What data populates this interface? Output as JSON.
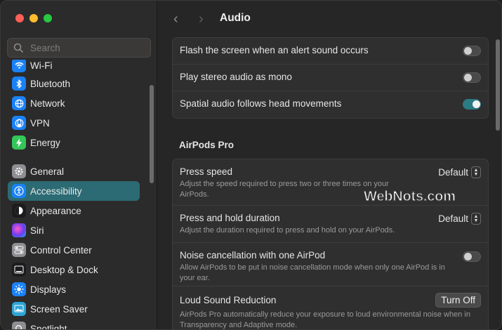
{
  "window": {
    "title": "Audio"
  },
  "sidebar": {
    "search_placeholder": "Search",
    "items": [
      {
        "label": "Wi-Fi",
        "icon": "wifi-icon",
        "color": "#1a82f7"
      },
      {
        "label": "Bluetooth",
        "icon": "bluetooth-icon",
        "color": "#1a82f7"
      },
      {
        "label": "Network",
        "icon": "globe-icon",
        "color": "#1a82f7"
      },
      {
        "label": "VPN",
        "icon": "vpn-icon",
        "color": "#1a82f7"
      },
      {
        "label": "Energy",
        "icon": "bolt-icon",
        "color": "#34c759"
      },
      {
        "label": "General",
        "icon": "gear-icon",
        "color": "#8e8e93"
      },
      {
        "label": "Accessibility",
        "icon": "accessibility-icon",
        "color": "#1a82f7",
        "active": true
      },
      {
        "label": "Appearance",
        "icon": "appearance-icon",
        "color": "#1c1c1e"
      },
      {
        "label": "Siri",
        "icon": "siri-icon",
        "color": "#8a4af3"
      },
      {
        "label": "Control Center",
        "icon": "control-center-icon",
        "color": "#8e8e93"
      },
      {
        "label": "Desktop & Dock",
        "icon": "dock-icon",
        "color": "#1c1c1e"
      },
      {
        "label": "Displays",
        "icon": "sun-icon",
        "color": "#1a82f7"
      },
      {
        "label": "Screen Saver",
        "icon": "screen-saver-icon",
        "color": "#2ea5d6"
      },
      {
        "label": "Spotlight",
        "icon": "spotlight-icon",
        "color": "#8e8e93"
      }
    ]
  },
  "main": {
    "top_rows": [
      {
        "label": "Flash the screen when an alert sound occurs",
        "toggle_on": false
      },
      {
        "label": "Play stereo audio as mono",
        "toggle_on": false
      },
      {
        "label": "Spatial audio follows head movements",
        "toggle_on": true
      }
    ],
    "airpods_section": "AirPods Pro",
    "airpods_rows": [
      {
        "label": "Press speed",
        "desc": "Adjust the speed required to press two or three times on your AirPods.",
        "value": "Default"
      },
      {
        "label": "Press and hold duration",
        "desc": "Adjust the duration required to press and hold on your AirPods.",
        "value": "Default"
      },
      {
        "label": "Noise cancellation with one AirPod",
        "desc": "Allow AirPods to be put in noise cancellation mode when only one AirPod is in your ear.",
        "toggle_on": false
      },
      {
        "label": "Loud Sound Reduction",
        "desc": "AirPods Pro automatically reduce your exposure to loud environmental noise when in Transparency and Adaptive mode.",
        "button": "Turn Off"
      }
    ]
  },
  "watermark": "WebNots.com",
  "colors": {
    "accent": "#2c7a84",
    "active_sidebar": "#2c6b73"
  }
}
